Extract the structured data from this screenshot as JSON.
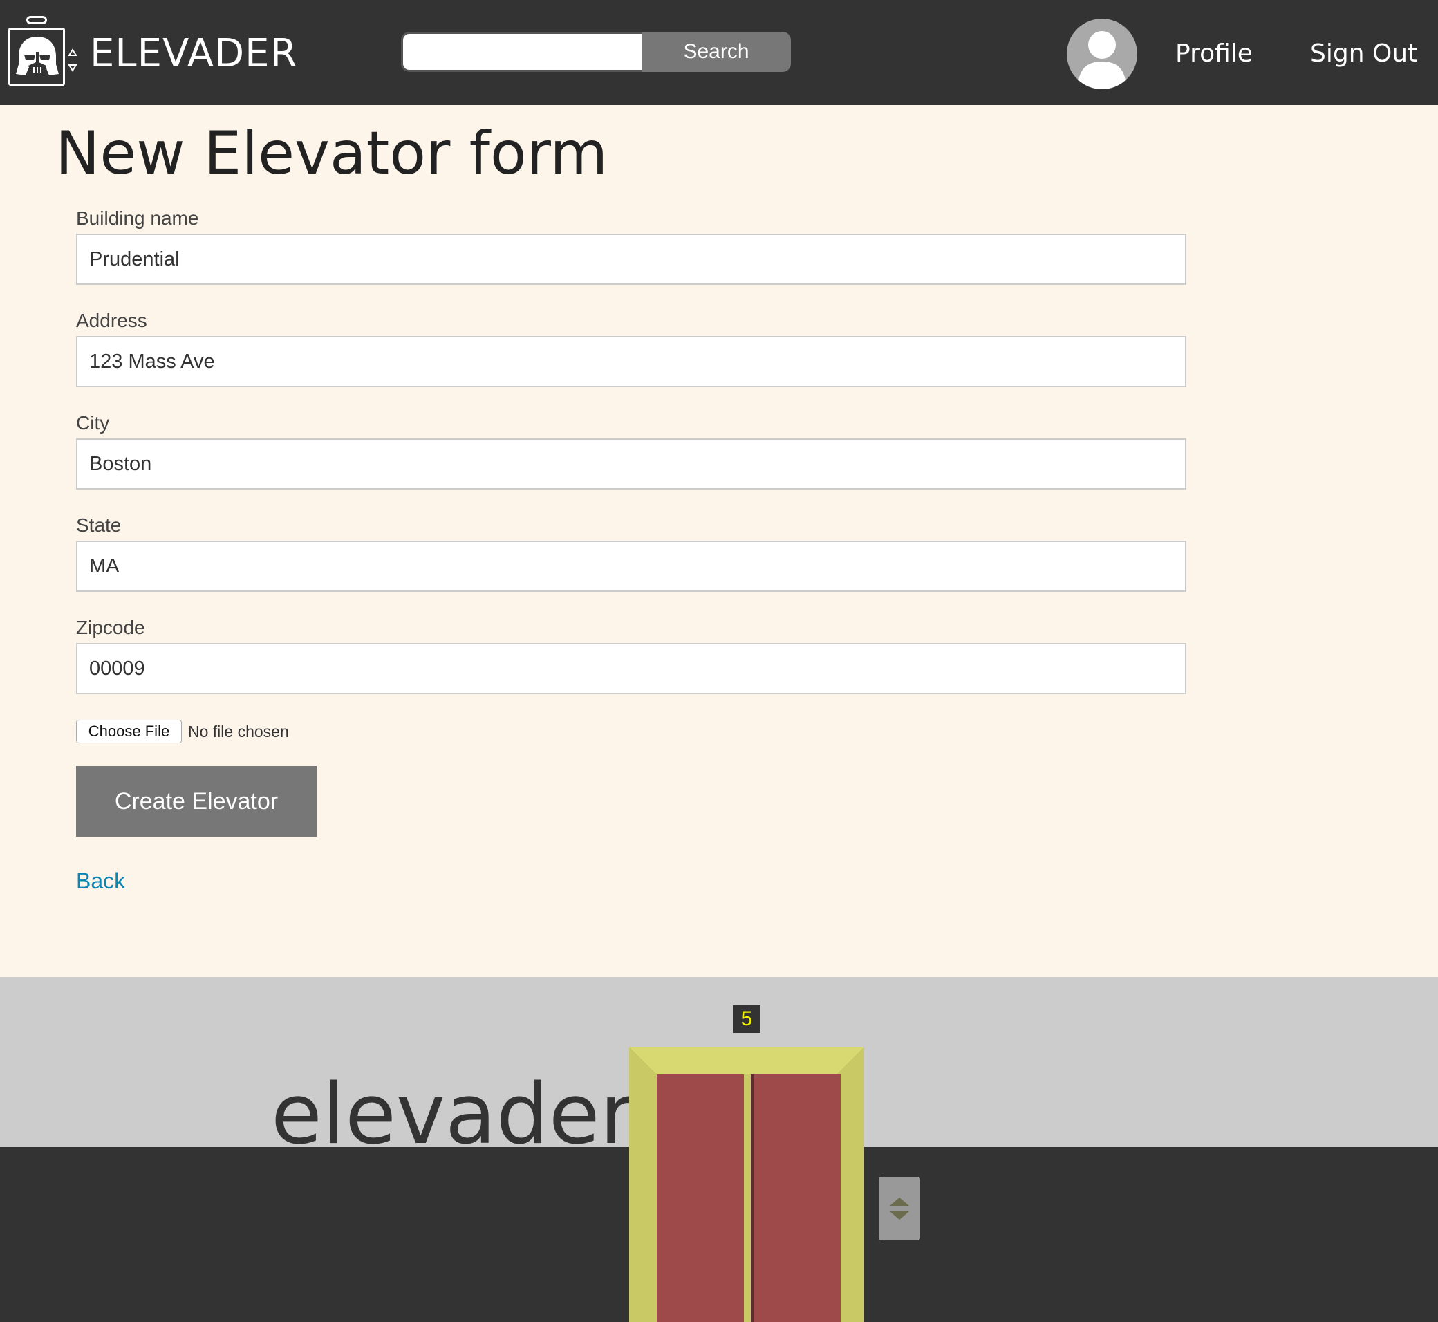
{
  "header": {
    "brand": "ELEVADER",
    "search": {
      "value": "",
      "placeholder": "",
      "button_label": "Search"
    },
    "nav": {
      "profile": "Profile",
      "sign_out": "Sign Out"
    }
  },
  "form": {
    "title": "New Elevator form",
    "fields": [
      {
        "label": "Building name",
        "value": "Prudential"
      },
      {
        "label": "Address",
        "value": "123 Mass Ave"
      },
      {
        "label": "City",
        "value": "Boston"
      },
      {
        "label": "State",
        "value": "MA"
      },
      {
        "label": "Zipcode",
        "value": "00009"
      }
    ],
    "file": {
      "button_label": "Choose File",
      "status": "No file chosen"
    },
    "submit_label": "Create Elevator",
    "back_label": "Back"
  },
  "footer": {
    "word": "elevader",
    "floor": "5"
  },
  "colors": {
    "header_bg": "#333333",
    "page_bg": "#fdf5ea",
    "button_gray": "#777777",
    "link_blue": "#0a86b5",
    "footer_light": "#cccccc",
    "elevator_frame": "#c9c965",
    "elevator_door": "#9e4a4a",
    "floor_digit": "#f2f200"
  },
  "icons": [
    "vader-elevator-logo-icon",
    "up-down-arrows-icon",
    "user-avatar-icon",
    "elevator-call-arrows-icon"
  ]
}
